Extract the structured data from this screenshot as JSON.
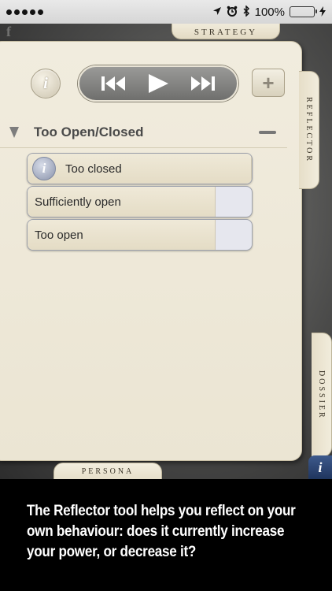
{
  "status_bar": {
    "battery_text": "100%",
    "battery_level": 1.0,
    "icons": [
      "signal-dots-icon",
      "location-arrow-icon",
      "alarm-icon",
      "bluetooth-icon",
      "battery-icon",
      "charging-bolt-icon"
    ]
  },
  "tabs": {
    "top": "STRATEGY",
    "bottom": "PERSONA",
    "side_upper": "REFLECTOR",
    "side_lower": "DOSSIER"
  },
  "toolbar": {
    "info_label": "i",
    "plus_label": "+",
    "transport_icons": [
      "skip-back-icon",
      "play-icon",
      "skip-forward-icon"
    ]
  },
  "section": {
    "title": "Too Open/Closed",
    "options": [
      {
        "label": "Too closed",
        "selected": true,
        "info": "i",
        "level": 1.0
      },
      {
        "label": "Sufficiently open",
        "selected": false,
        "level": 0.84
      },
      {
        "label": "Too open",
        "selected": false,
        "level": 0.84
      }
    ]
  },
  "corner_info": "i",
  "caption": "The Reflector tool helps you reflect on your own behaviour: does it currently increase your power, or decrease it?",
  "colors": {
    "panel": "#ebe5d3",
    "accent_blue": "#1f355e",
    "battery_green": "#4cd964",
    "option_border": "#9da1ab"
  }
}
